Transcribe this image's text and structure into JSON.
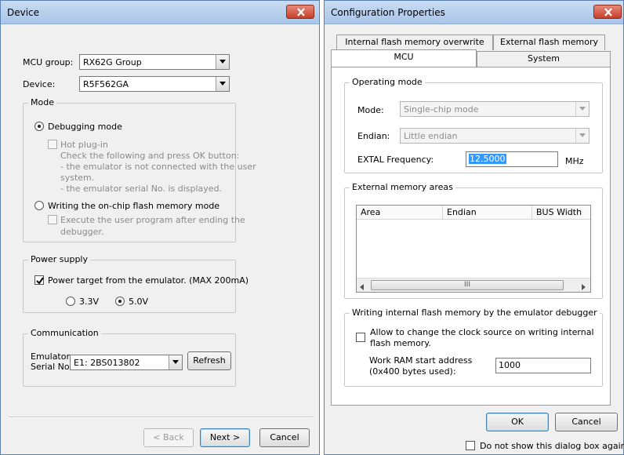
{
  "device_window": {
    "title": "Device",
    "mcu_group_label": "MCU group:",
    "mcu_group_value": "RX62G Group",
    "device_label": "Device:",
    "device_value": "R5F562GA",
    "mode_group": {
      "title": "Mode",
      "debugging_mode": "Debugging mode",
      "hot_plugin": "Hot plug-in",
      "hot_plugin_desc": [
        "Check the following and press OK button:",
        "- the emulator is not connected with the user",
        "system.",
        "- the emulator serial No. is displayed."
      ],
      "writing_flash_mode": "Writing the on-chip flash memory mode",
      "execute_after_debug": [
        "Execute the user program after ending the",
        "debugger."
      ]
    },
    "power_group": {
      "title": "Power supply",
      "power_target": "Power target from the emulator. (MAX 200mA)",
      "opt_33": "3.3V",
      "opt_50": "5.0V"
    },
    "comm_group": {
      "title": "Communication",
      "emulator_label": [
        "Emulator",
        "Serial No.:"
      ],
      "emulator_value": "E1: 2BS013802",
      "refresh": "Refresh"
    },
    "back": "< Back",
    "next": "Next >",
    "cancel": "Cancel"
  },
  "config_window": {
    "title": "Configuration Properties",
    "tabs_back": [
      "Internal flash memory overwrite",
      "External flash memory"
    ],
    "tabs_front": [
      "MCU",
      "System"
    ],
    "operating_mode": {
      "title": "Operating mode",
      "mode_label": "Mode:",
      "mode_value": "Single-chip mode",
      "endian_label": "Endian:",
      "endian_value": "Little endian",
      "extal_label": "EXTAL Frequency:",
      "extal_value": "12.5000",
      "extal_unit": "MHz"
    },
    "external_memory": {
      "title": "External memory areas",
      "columns": [
        "Area",
        "Endian",
        "BUS Width"
      ],
      "scroll_thumb_grip": "III"
    },
    "writing_flash": {
      "title": "Writing internal flash memory by the emulator debugger",
      "allow_change": [
        "Allow to change the clock source on writing internal",
        "flash memory."
      ],
      "work_ram_label": [
        "Work RAM start address",
        "(0x400 bytes used):"
      ],
      "work_ram_value": "1000"
    },
    "ok": "OK",
    "cancel": "Cancel",
    "dont_show": "Do not show this dialog box again."
  },
  "colors": {
    "title_gradient_top": "#c9dcf2",
    "close_button": "#c8402a",
    "selection": "#3399ff"
  }
}
